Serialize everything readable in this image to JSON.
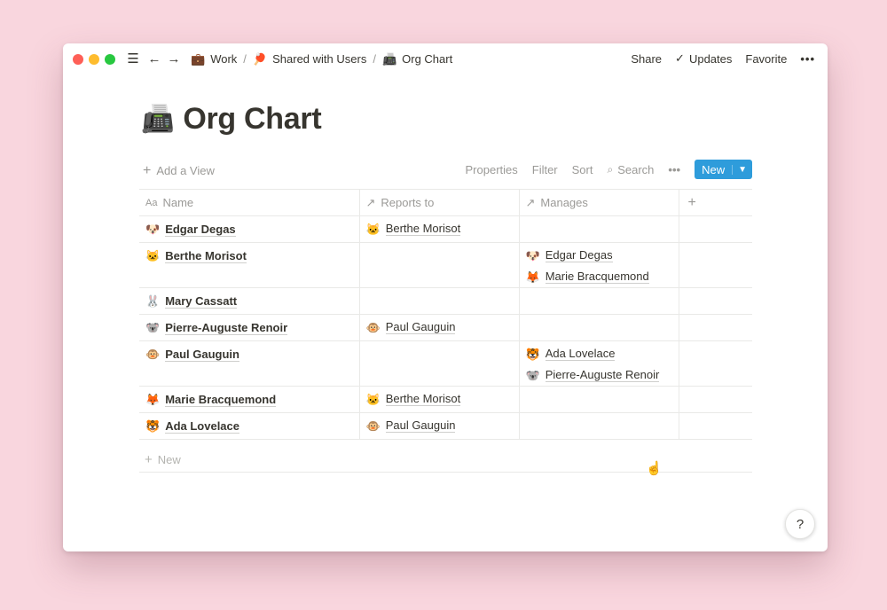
{
  "titlebar": {
    "breadcrumbs": [
      {
        "emoji": "💼",
        "label": "Work"
      },
      {
        "emoji": "🏓",
        "label": "Shared with Users"
      },
      {
        "emoji": "📠",
        "label": "Org Chart"
      }
    ],
    "sep": "/",
    "actions": {
      "share": "Share",
      "updates": "Updates",
      "favorite": "Favorite",
      "more": "•••"
    }
  },
  "page": {
    "emoji": "📠",
    "title": "Org Chart"
  },
  "viewbar": {
    "add_view": "Add a View",
    "properties": "Properties",
    "filter": "Filter",
    "sort": "Sort",
    "search": "Search",
    "more": "•••",
    "new": "New"
  },
  "table": {
    "columns": [
      {
        "icon": "Aa",
        "label": "Name"
      },
      {
        "icon": "↗",
        "label": "Reports to"
      },
      {
        "icon": "↗",
        "label": "Manages"
      },
      {
        "icon": "+",
        "label": ""
      }
    ],
    "rows": [
      {
        "emoji": "🐶",
        "name": "Edgar Degas",
        "reports_to": [
          {
            "emoji": "🐱",
            "name": "Berthe Morisot"
          }
        ],
        "manages": []
      },
      {
        "emoji": "🐱",
        "name": "Berthe Morisot",
        "reports_to": [],
        "manages": [
          {
            "emoji": "🐶",
            "name": "Edgar Degas"
          },
          {
            "emoji": "🦊",
            "name": "Marie Bracquemond"
          }
        ]
      },
      {
        "emoji": "🐰",
        "name": "Mary Cassatt",
        "reports_to": [],
        "manages": []
      },
      {
        "emoji": "🐨",
        "name": "Pierre-Auguste Renoir",
        "reports_to": [
          {
            "emoji": "🐵",
            "name": "Paul Gauguin"
          }
        ],
        "manages": []
      },
      {
        "emoji": "🐵",
        "name": "Paul Gauguin",
        "reports_to": [],
        "manages": [
          {
            "emoji": "🐯",
            "name": "Ada Lovelace"
          },
          {
            "emoji": "🐨",
            "name": "Pierre-Auguste Renoir"
          }
        ]
      },
      {
        "emoji": "🦊",
        "name": "Marie Bracquemond",
        "reports_to": [
          {
            "emoji": "🐱",
            "name": "Berthe Morisot"
          }
        ],
        "manages": []
      },
      {
        "emoji": "🐯",
        "name": "Ada Lovelace",
        "reports_to": [
          {
            "emoji": "🐵",
            "name": "Paul Gauguin"
          }
        ],
        "manages": []
      }
    ],
    "new_row": "New"
  },
  "help": "?"
}
